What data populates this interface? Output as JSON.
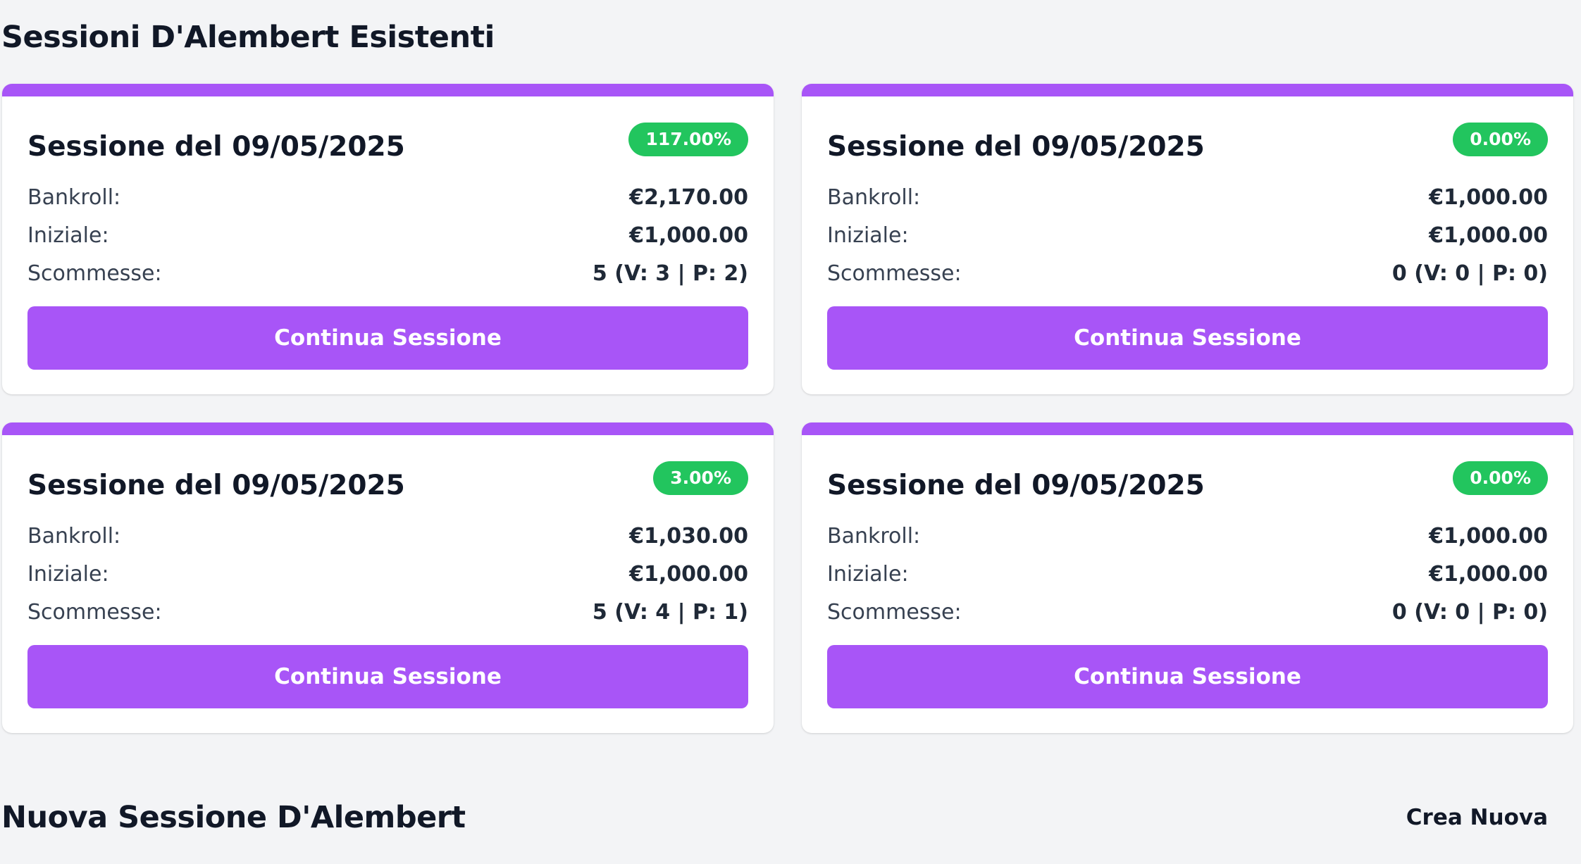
{
  "page": {
    "title": "Sessioni D'Alembert Esistenti"
  },
  "labels": {
    "bankroll": "Bankroll:",
    "iniziale": "Iniziale:",
    "scommesse": "Scommesse:",
    "continue": "Continua Sessione"
  },
  "sessions": [
    {
      "title": "Sessione del 09/05/2025",
      "percent": "117.00%",
      "bankroll": "€2,170.00",
      "initial": "€1,000.00",
      "bets": "5 (V: 3 | P: 2)"
    },
    {
      "title": "Sessione del 09/05/2025",
      "percent": "0.00%",
      "bankroll": "€1,000.00",
      "initial": "€1,000.00",
      "bets": "0 (V: 0 | P: 0)"
    },
    {
      "title": "Sessione del 09/05/2025",
      "percent": "3.00%",
      "bankroll": "€1,030.00",
      "initial": "€1,000.00",
      "bets": "5 (V: 4 | P: 1)"
    },
    {
      "title": "Sessione del 09/05/2025",
      "percent": "0.00%",
      "bankroll": "€1,000.00",
      "initial": "€1,000.00",
      "bets": "0 (V: 0 | P: 0)"
    }
  ],
  "new_session": {
    "title": "Nuova Sessione D'Alembert",
    "create_label": "Crea Nuova"
  },
  "colors": {
    "accent": "#a855f7",
    "badge": "#22c55e",
    "background": "#f3f4f6"
  }
}
